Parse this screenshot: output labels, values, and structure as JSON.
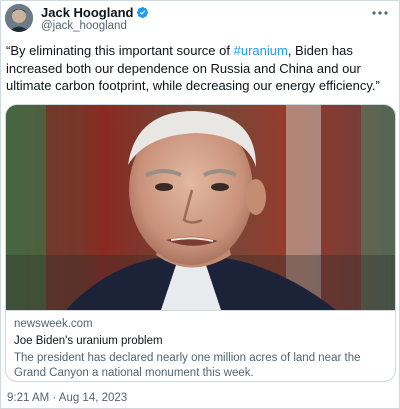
{
  "author": {
    "display_name": "Jack Hoogland",
    "handle": "@jack_hoogland",
    "verified": true,
    "verified_color": "#1d9bf0"
  },
  "tweet": {
    "text_before": "“By eliminating this important source of ",
    "hashtag": "#uranium",
    "text_after": ", Biden has increased both our dependence on Russia and China and our ultimate carbon footprint, while decreasing our energy efficiency.”",
    "hashtag_color": "#1d9bf0"
  },
  "card": {
    "domain": "newsweek.com",
    "title": "Joe Biden's uranium problem",
    "description": "The president has declared nearly one million acres of land near the Grand Canyon a national monument this week.",
    "image_icon": "news-photo-man-in-suit"
  },
  "timestamp": "9:21 AM · Aug 14, 2023",
  "icons": {
    "more": "more-horizontal-icon",
    "verified": "verified-badge-icon"
  },
  "colors": {
    "text": "#0f1419",
    "secondary_text": "#536471",
    "border": "#cfd9de",
    "accent": "#1d9bf0"
  }
}
